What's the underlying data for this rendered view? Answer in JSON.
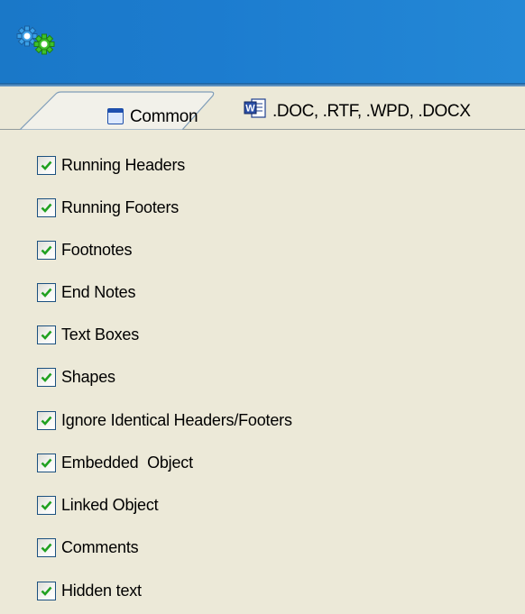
{
  "tabs": [
    {
      "label": "Common",
      "icon": "window-icon"
    },
    {
      "label": ".DOC, .RTF, .WPD, .DOCX",
      "icon": "word-document-icon"
    }
  ],
  "options": [
    {
      "label": "Running Headers",
      "checked": true
    },
    {
      "label": "Running Footers",
      "checked": true
    },
    {
      "label": "Footnotes",
      "checked": true
    },
    {
      "label": "End Notes",
      "checked": true
    },
    {
      "label": "Text Boxes",
      "checked": true
    },
    {
      "label": "Shapes",
      "checked": true
    },
    {
      "label": "Ignore Identical Headers/Footers",
      "checked": true
    },
    {
      "label": "Embedded  Object",
      "checked": true
    },
    {
      "label": "Linked Object",
      "checked": true
    },
    {
      "label": "Comments",
      "checked": true
    },
    {
      "label": "Hidden text",
      "checked": true
    }
  ],
  "colors": {
    "header": "#1c7ccf",
    "panel": "#ece9d8",
    "check": "#21a121"
  }
}
